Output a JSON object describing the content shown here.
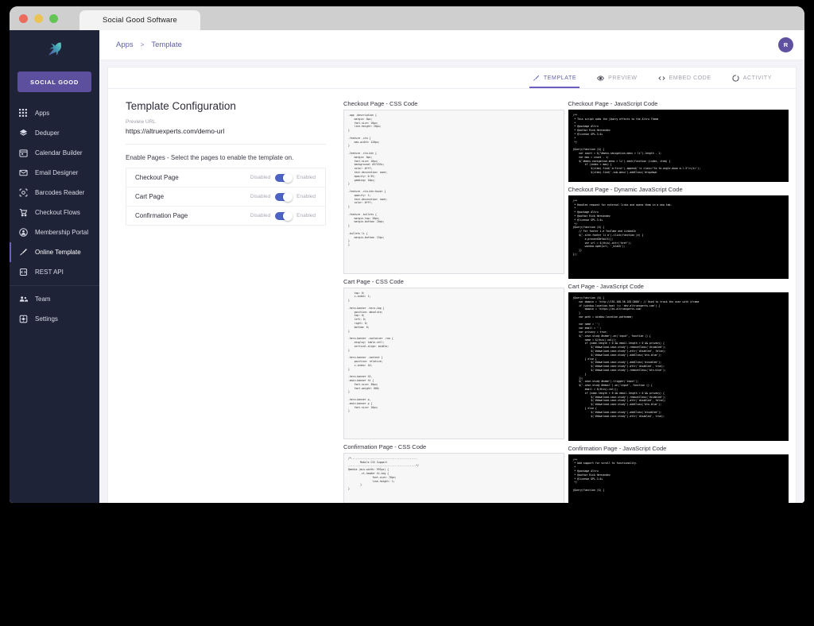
{
  "window": {
    "tab_title": "Social Good Software"
  },
  "sidebar": {
    "brand_label": "SOCIAL GOOD",
    "items": [
      {
        "label": "Apps",
        "icon": "grid-icon"
      },
      {
        "label": "Deduper",
        "icon": "layers-icon"
      },
      {
        "label": "Calendar Builder",
        "icon": "calendar-icon"
      },
      {
        "label": "Email Designer",
        "icon": "envelope-icon"
      },
      {
        "label": "Barcodes Reader",
        "icon": "barcode-scan-icon"
      },
      {
        "label": "Checkout Flows",
        "icon": "cart-icon"
      },
      {
        "label": "Membership Portal",
        "icon": "user-circle-icon"
      },
      {
        "label": "Online Template",
        "icon": "brush-icon"
      },
      {
        "label": "REST API",
        "icon": "api-icon"
      },
      {
        "label": "Team",
        "icon": "people-icon"
      },
      {
        "label": "Settings",
        "icon": "gear-icon"
      }
    ]
  },
  "topbar": {
    "breadcrumb": {
      "root": "Apps",
      "separator": ">",
      "current": "Template"
    },
    "avatar_initial": "R"
  },
  "tabs": [
    {
      "label": "TEMPLATE",
      "icon": "brush-icon",
      "active": true
    },
    {
      "label": "PREVIEW",
      "icon": "eye-icon",
      "active": false
    },
    {
      "label": "EMBED CODE",
      "icon": "code-icon",
      "active": false
    },
    {
      "label": "ACTIVITY",
      "icon": "spinner-icon",
      "active": false
    }
  ],
  "config": {
    "title": "Template Configuration",
    "preview_url_label": "Preview URL",
    "preview_url_value": "https://altruexperts.com/demo-url",
    "enable_pages_label": "Enable Pages - Select the pages to enable the template on.",
    "toggle_off_label": "Disabled",
    "toggle_on_label": "Enabled",
    "pages": [
      {
        "name": "Checkout Page",
        "enabled": true
      },
      {
        "name": "Cart Page",
        "enabled": true
      },
      {
        "name": "Confirmation Page",
        "enabled": true
      }
    ]
  },
  "code_blocks": {
    "checkout_css": {
      "heading": "Checkout Page - CSS Code",
      "code": ".app .description {\n    margin: 0px;\n    font-size: 16px;\n    line-height: 20px;\n}\n\n.feature .cta {\n    max-width: 120px;\n}\n\n.feature .cta-btn {\n    margin: 0px;\n    font-size: 16px;\n    background: #37434c;\n    color: #fff;\n    text-decoration: none;\n    opacity: 0.95;\n    padding: 10px;\n}\n\n.feature .cta-btn:hover {\n    opacity: 1;\n    text-decoration: none;\n    color: #fff;\n}\n\n.feature .bullets {\n    margin-top: 20px;\n    margin-bottom: 20px;\n}\n\n.bullets li {\n    margin-bottom: 15px;\n}\n}"
    },
    "checkout_js": {
      "heading": "Checkout Page - JavaScript Code",
      "code": "/**\n * This script adds the jQuery effects to the Altru Theme\n *\n * @package Altru\n * @author Rick Hernandez\n * @license GPL-3.0+\n *\n */\n\njQuery(function ($) {\n    var count = $(\"#menu-navigation-menu > li\").length - 1;\n    var max = count - 1;\n    $('#menu-navigation-menu > li').each(function (index, item) {\n        if (index < max) {\n            $(item).find('a:first').append('<i class=\"fa fa-angle-down m-l-5\"></i>');\n            $(item).find('.sub-menu').addClass('dropdown"
    },
    "checkout_dynamic_js": {
      "heading": "Checkout Page - Dynamic JavaScript Code",
      "code": "/**\n * Handles request for external links and opens them in a new tab.\n *\n * @package Altru\n * @author Rick Hernandez\n * @license GPL-3.0+\n */\njQuery(function ($) {\n    // For footer i.e YouTube and LinkedIn\n    $('.site-footer li a').click(function (e) {\n        e.preventDefault();\n        var url = $(this).attr('href');\n        window.open(url, '_blank');\n    })\n});"
    },
    "cart_css": {
      "heading": "Cart Page - CSS Code",
      "code": "    top: 0;\n    z-index: 1;\n}\n\n.hero-banner .hero-img {\n    position: absolute;\n    top: 0;\n    left: 0;\n    right: 0;\n    bottom: 0;\n}\n\n.hero-banner .container .row {\n    display: table-cell;\n    vertical-align: middle;\n}\n\n.hero-banner .content {\n    position: relative;\n    z-index: 10;\n}\n\n.hero-banner h2,\n.main-banner h1 {\n    font-size: 30px;\n    font-weight: 600;\n}\n\n.hero-banner p,\n.main-banner p {\n    font-size: 16px;\n}"
    },
    "cart_js": {
      "heading": "Cart Page - JavaScript Code",
      "code": "jQuery(function ($) {\n    var domain = 'http://192.168.56.103:3000'; // Used to track the user with iframe\n    if (window.location.host !== 'dev.altruexperts.com') {\n        domain = 'https://ex.altruexperts.com'\n    }\n    var path = window.location.pathname;\n\n    var name = '';\n    var email = '';\n    var privacy = true;\n    $('.case-study #name').on('input', function () {\n        name = $(this).val();\n        if (name.length > 0 && email.length > 0 && privacy) {\n            $('#download-case-study').removeClass('disabled');\n            $('#download-case-study').attr('disabled', false);\n            $('#download-case-study').addClass('btn-blue');\n        } else {\n            $('#download-case-study').addClass('disabled');\n            $('#download-case-study').attr('disabled', true);\n            $('#download-case-study').removeClass('btn-blue');\n        }\n    });\n    $('.case-study #name').trigger('input');\n    $('.case-study #email').on('input', function () {\n        email = $(this).val();\n        if (name.length > 0 && email.length > 0 && privacy) {\n            $('#download-case-study').removeClass('disabled');\n            $('#download-case-study').attr('disabled', false);\n            $('#download-case-study').addClass('btn-blue');\n        } else {\n            $('#download-case-study').addClass('disabled');\n            $('#download-case-study').attr('disabled', true);"
    },
    "confirmation_css": {
      "heading": "Confirmation Page - CSS Code",
      "code": "/*--------------------------------------------\n        Mobile CSS Support\n---------------------------------------------*/\n@media (min-width: 992px) {\n        .ct-header h1.big {\n                font-size: 70px;\n                line-height: 1;\n        }\n}"
    },
    "confirmation_js": {
      "heading": "Confirmation Page - JavaScript Code",
      "code": "/**\n * Add support for scroll to functionality.\n *\n * @package Altru\n * @author Rick Hernandez\n * @license GPL-3.0+\n */\n\njQuery(function ($) {"
    }
  },
  "colors": {
    "sidebar_bg": "#1f2337",
    "brand_purple": "#5b4f9e",
    "accent_purple": "#6c5fc3",
    "toggle_blue": "#4c63c4",
    "page_bg": "#f4f4f8"
  }
}
